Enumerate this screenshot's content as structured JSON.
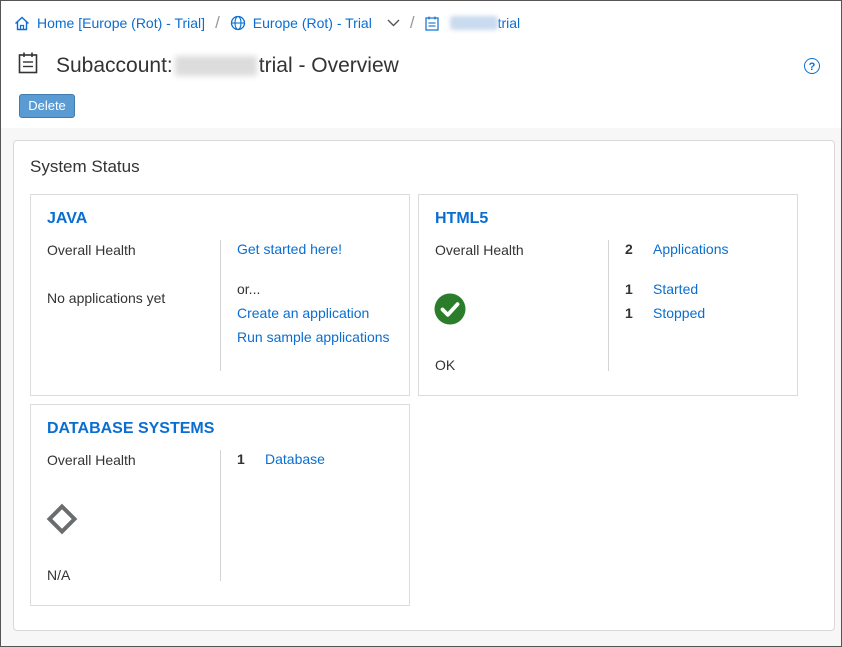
{
  "breadcrumb": {
    "home_label": "Home [Europe (Rot) - Trial]",
    "region_label": "Europe (Rot) - Trial",
    "subaccount_suffix": "trial",
    "separator": "/"
  },
  "header": {
    "title_prefix": "Subaccount:",
    "title_suffix": "trial - Overview",
    "help_symbol": "?",
    "delete_label": "Delete"
  },
  "system_status": {
    "heading": "System Status",
    "java": {
      "title": "JAVA",
      "health_label": "Overall Health",
      "status_text": "No applications yet",
      "get_started": "Get started here!",
      "or_text": "or...",
      "create_app": "Create an application",
      "run_samples": "Run sample applications"
    },
    "html5": {
      "title": "HTML5",
      "health_label": "Overall Health",
      "health_status": "OK",
      "health_icon": "check-circle-icon",
      "applications_count": "2",
      "applications_label": "Applications",
      "started_count": "1",
      "started_label": "Started",
      "stopped_count": "1",
      "stopped_label": "Stopped"
    },
    "database": {
      "title": "DATABASE SYSTEMS",
      "health_label": "Overall Health",
      "health_status": "N/A",
      "health_icon": "diamond-outline-icon",
      "database_count": "1",
      "database_label": "Database"
    }
  },
  "colors": {
    "link": "#0a6ed1",
    "ok_green": "#2b7d2b",
    "na_grey": "#6a6d70",
    "button": "#5a9bd4"
  }
}
